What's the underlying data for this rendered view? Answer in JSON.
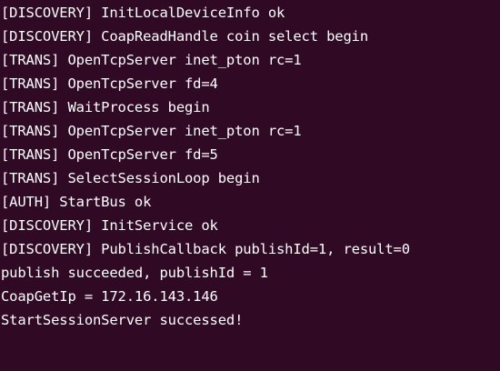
{
  "terminal": {
    "lines": [
      "[DISCOVERY] InitLocalDeviceInfo ok",
      "[DISCOVERY] CoapReadHandle coin select begin",
      "[TRANS] OpenTcpServer inet_pton rc=1",
      "[TRANS] OpenTcpServer fd=4",
      "[TRANS] WaitProcess begin",
      "[TRANS] OpenTcpServer inet_pton rc=1",
      "[TRANS] OpenTcpServer fd=5",
      "[TRANS] SelectSessionLoop begin",
      "[AUTH] StartBus ok",
      "[DISCOVERY] InitService ok",
      "[DISCOVERY] PublishCallback publishId=1, result=0",
      "publish succeeded, publishId = 1",
      "CoapGetIp = 172.16.143.146",
      "StartSessionServer successed!"
    ]
  },
  "colors": {
    "background": "#300a24",
    "text": "#ffffff"
  }
}
